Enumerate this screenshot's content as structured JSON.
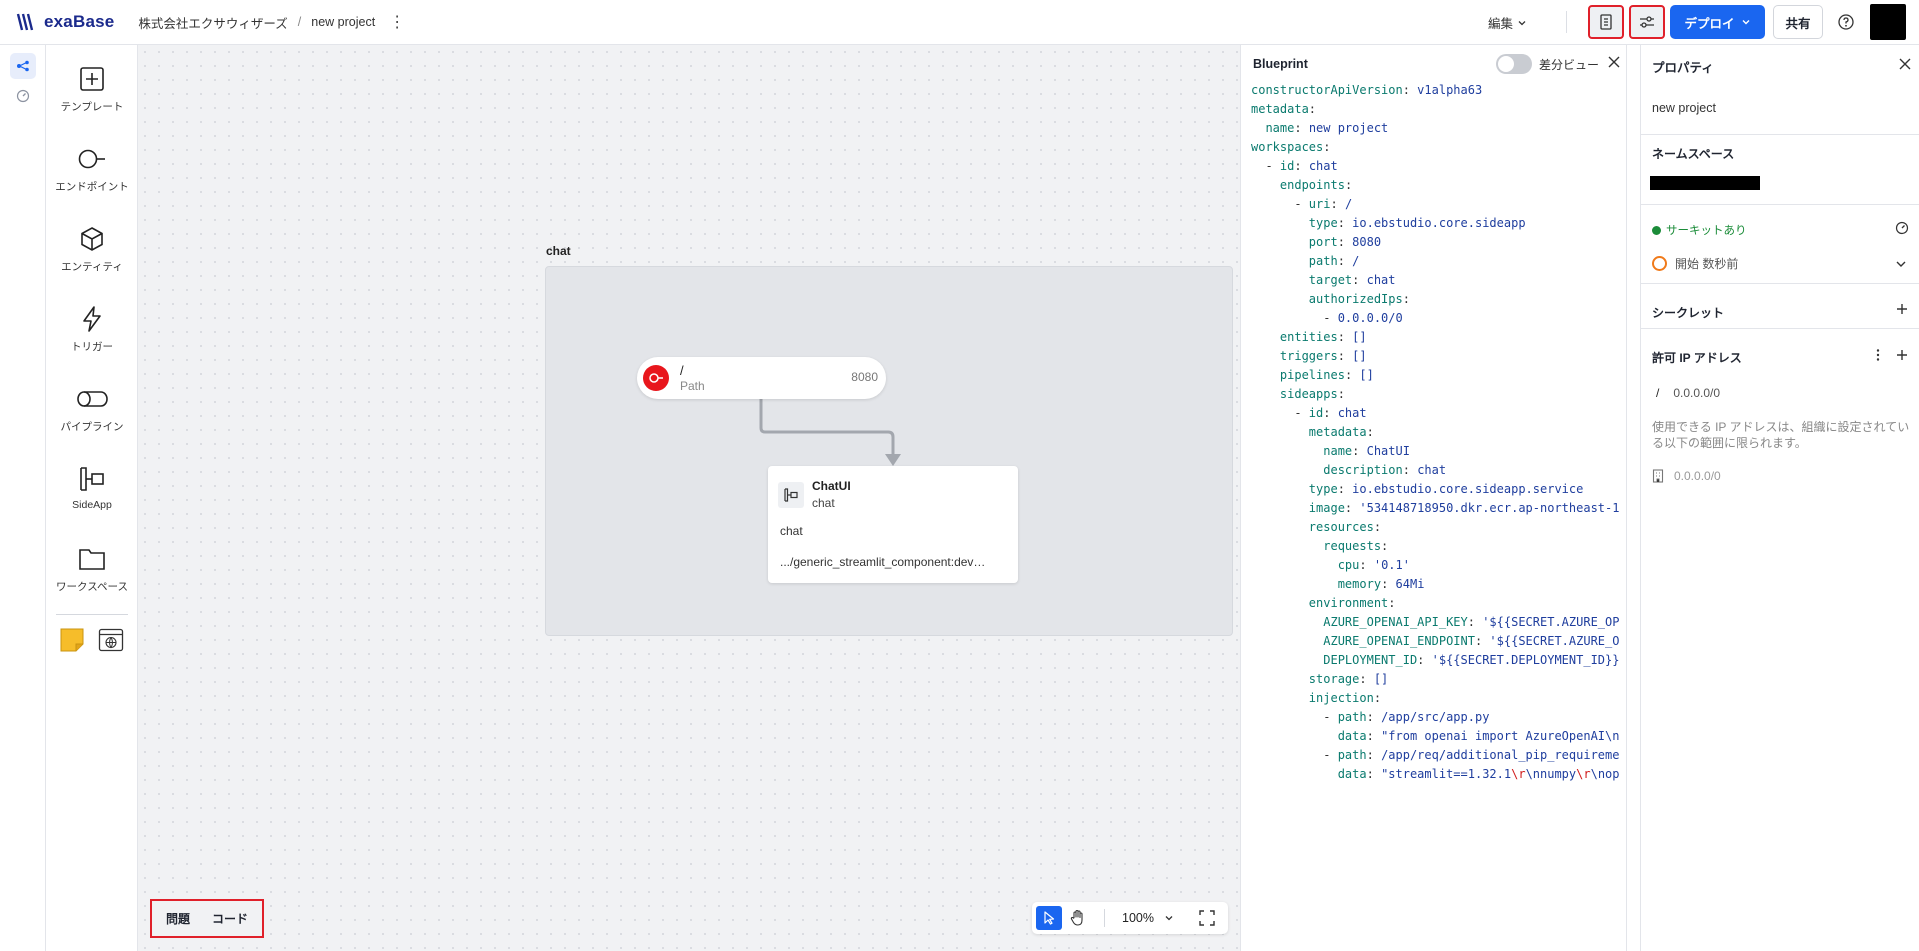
{
  "header": {
    "logo_text": "exaBase",
    "org": "株式会社エクサウィザーズ",
    "separator": "/",
    "project": "new project",
    "edit_label": "編集",
    "deploy_label": "デプロイ",
    "share_label": "共有"
  },
  "palette": {
    "items": [
      {
        "label": "テンプレート",
        "icon": "plus-square-icon"
      },
      {
        "label": "エンドポイント",
        "icon": "endpoint-icon"
      },
      {
        "label": "エンティティ",
        "icon": "cube-icon"
      },
      {
        "label": "トリガー",
        "icon": "lightning-icon"
      },
      {
        "label": "パイプライン",
        "icon": "pipeline-icon"
      },
      {
        "label": "SideApp",
        "icon": "sideapp-icon"
      },
      {
        "label": "ワークスペース",
        "icon": "workspace-icon"
      }
    ]
  },
  "canvas": {
    "group_label": "chat",
    "endpoint": {
      "path": "/",
      "sub": "Path",
      "port": "8080"
    },
    "sideapp": {
      "name": "ChatUI",
      "workspace": "chat",
      "description": "chat",
      "image": ".../generic_streamlit_component:dev…"
    },
    "bottom_tabs": {
      "issues": "問題",
      "code": "コード"
    },
    "zoom": "100%"
  },
  "blueprint": {
    "title": "Blueprint",
    "diff_label": "差分ビュー",
    "diff_enabled": false
  },
  "properties": {
    "title": "プロパティ",
    "project_name": "new project",
    "namespace_title": "ネームスペース",
    "circuit_label": "サーキットあり",
    "status_label": "開始 数秒前",
    "secret_title": "シークレット",
    "ip_title": "許可 IP アドレス",
    "ip_path": "/",
    "ip_value": "0.0.0.0/0",
    "ip_note": "使用できる IP アドレスは、組織に設定されている以下の範囲に限られます。",
    "ip_limit": "0.0.0.0/0"
  },
  "colors": {
    "accent": "#1a66f0",
    "highlight": "#e0202a",
    "endpoint": "#e8161c",
    "running": "#1b8c39",
    "starting": "#f07a1a"
  }
}
